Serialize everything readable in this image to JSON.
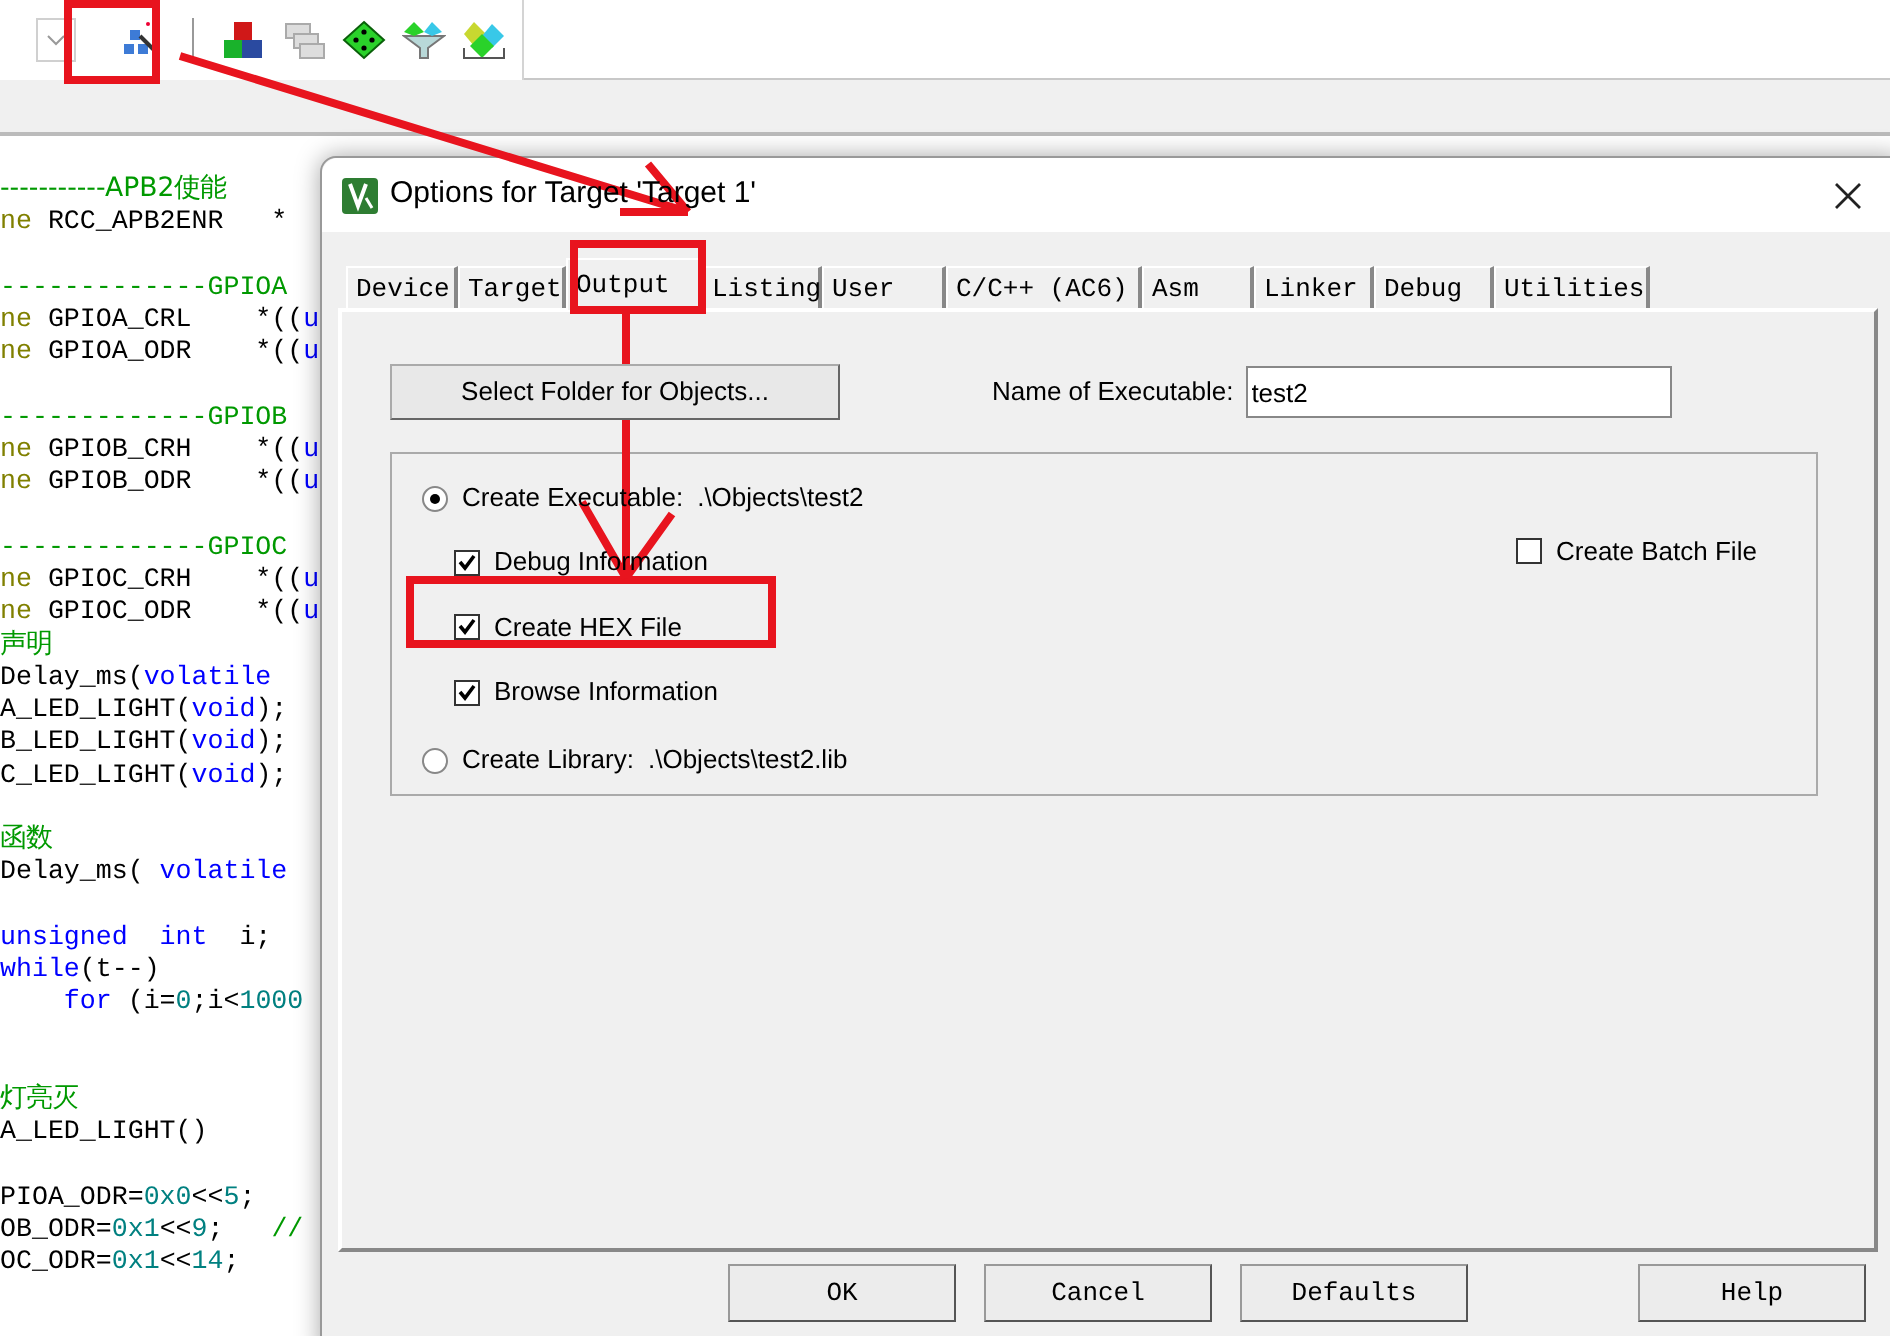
{
  "toolbar": {
    "buttons": [
      {
        "kind": "dropdown"
      },
      {
        "kind": "wand"
      },
      {
        "kind": "separator"
      },
      {
        "kind": "blocks"
      },
      {
        "kind": "windows"
      },
      {
        "kind": "diamond"
      },
      {
        "kind": "funnel"
      },
      {
        "kind": "packs"
      }
    ]
  },
  "code": {
    "lines": [
      {
        "kind": "code",
        "segments": [
          {
            "kind": "comment",
            "t": "-----------APB2使能"
          }
        ]
      },
      {
        "kind": "code",
        "segments": [
          {
            "kind": "macro",
            "t": "ne"
          },
          {
            "kind": "plain",
            "t": " RCC_APB2ENR   *"
          }
        ]
      },
      {
        "kind": "blank"
      },
      {
        "kind": "code",
        "segments": [
          {
            "kind": "comment",
            "t": "-------------GPIOA"
          }
        ]
      },
      {
        "kind": "code",
        "segments": [
          {
            "kind": "macro",
            "t": "ne"
          },
          {
            "kind": "plain",
            "t": " GPIOA_CRL    *(("
          },
          {
            "kind": "keyword",
            "t": "u"
          }
        ]
      },
      {
        "kind": "code",
        "segments": [
          {
            "kind": "macro",
            "t": "ne"
          },
          {
            "kind": "plain",
            "t": " GPIOA_ODR    *(("
          },
          {
            "kind": "keyword",
            "t": "u"
          }
        ]
      },
      {
        "kind": "blank"
      },
      {
        "kind": "code",
        "segments": [
          {
            "kind": "comment",
            "t": "-------------GPIOB"
          }
        ]
      },
      {
        "kind": "code",
        "segments": [
          {
            "kind": "macro",
            "t": "ne"
          },
          {
            "kind": "plain",
            "t": " GPIOB_CRH    *(("
          },
          {
            "kind": "keyword",
            "t": "u"
          }
        ]
      },
      {
        "kind": "code",
        "segments": [
          {
            "kind": "macro",
            "t": "ne"
          },
          {
            "kind": "plain",
            "t": " GPIOB_ODR    *(("
          },
          {
            "kind": "keyword",
            "t": "u"
          }
        ]
      },
      {
        "kind": "blank"
      },
      {
        "kind": "code",
        "segments": [
          {
            "kind": "comment",
            "t": "-------------GPIOC"
          }
        ]
      },
      {
        "kind": "code",
        "segments": [
          {
            "kind": "macro",
            "t": "ne"
          },
          {
            "kind": "plain",
            "t": " GPIOC_CRH    *(("
          },
          {
            "kind": "keyword",
            "t": "u"
          }
        ]
      },
      {
        "kind": "code",
        "segments": [
          {
            "kind": "macro",
            "t": "ne"
          },
          {
            "kind": "plain",
            "t": " GPIOC_ODR    *(("
          },
          {
            "kind": "keyword",
            "t": "u"
          }
        ]
      },
      {
        "kind": "code",
        "segments": [
          {
            "kind": "comment",
            "t": "声明"
          }
        ]
      },
      {
        "kind": "code",
        "segments": [
          {
            "kind": "plain",
            "t": "Delay_ms("
          },
          {
            "kind": "keyword",
            "t": "volatile"
          }
        ]
      },
      {
        "kind": "code",
        "segments": [
          {
            "kind": "plain",
            "t": "A_LED_LIGHT("
          },
          {
            "kind": "keyword",
            "t": "void"
          },
          {
            "kind": "plain",
            "t": ");"
          }
        ]
      },
      {
        "kind": "code",
        "segments": [
          {
            "kind": "plain",
            "t": "B_LED_LIGHT("
          },
          {
            "kind": "keyword",
            "t": "void"
          },
          {
            "kind": "plain",
            "t": ");"
          }
        ]
      },
      {
        "kind": "code",
        "segments": [
          {
            "kind": "plain",
            "t": "C_LED_LIGHT("
          },
          {
            "kind": "keyword",
            "t": "void"
          },
          {
            "kind": "plain",
            "t": ");"
          }
        ]
      },
      {
        "kind": "blank"
      },
      {
        "kind": "code",
        "segments": [
          {
            "kind": "comment",
            "t": "函数"
          }
        ]
      },
      {
        "kind": "code",
        "segments": [
          {
            "kind": "plain",
            "t": "Delay_ms( "
          },
          {
            "kind": "keyword",
            "t": "volatile"
          }
        ]
      },
      {
        "kind": "blank"
      },
      {
        "kind": "code",
        "segments": [
          {
            "kind": "keyword",
            "t": "unsigned  int"
          },
          {
            "kind": "plain",
            "t": "  i;"
          }
        ]
      },
      {
        "kind": "code",
        "segments": [
          {
            "kind": "keyword",
            "t": "while"
          },
          {
            "kind": "plain",
            "t": "(t--)"
          }
        ]
      },
      {
        "kind": "code",
        "segments": [
          {
            "kind": "keyword",
            "t": "    for"
          },
          {
            "kind": "plain",
            "t": " (i="
          },
          {
            "kind": "number",
            "t": "0"
          },
          {
            "kind": "plain",
            "t": ";i<"
          },
          {
            "kind": "number",
            "t": "1000"
          }
        ]
      },
      {
        "kind": "blank"
      },
      {
        "kind": "blank"
      },
      {
        "kind": "code",
        "segments": [
          {
            "kind": "comment",
            "t": "灯亮灭"
          }
        ]
      },
      {
        "kind": "code",
        "segments": [
          {
            "kind": "plain",
            "t": "A_LED_LIGHT()"
          }
        ]
      },
      {
        "kind": "blank"
      },
      {
        "kind": "code",
        "segments": [
          {
            "kind": "plain",
            "t": "PIOA_ODR="
          },
          {
            "kind": "number",
            "t": "0x0"
          },
          {
            "kind": "plain",
            "t": "<<"
          },
          {
            "kind": "number",
            "t": "5"
          },
          {
            "kind": "plain",
            "t": ";"
          }
        ]
      },
      {
        "kind": "code",
        "segments": [
          {
            "kind": "plain",
            "t": "OB_ODR="
          },
          {
            "kind": "number",
            "t": "0x1"
          },
          {
            "kind": "plain",
            "t": "<<"
          },
          {
            "kind": "number",
            "t": "9"
          },
          {
            "kind": "plain",
            "t": ";   "
          },
          {
            "kind": "comment",
            "t": "//"
          }
        ]
      },
      {
        "kind": "code",
        "segments": [
          {
            "kind": "plain",
            "t": "OC_ODR="
          },
          {
            "kind": "number",
            "t": "0x1"
          },
          {
            "kind": "plain",
            "t": "<<"
          },
          {
            "kind": "number",
            "t": "14"
          },
          {
            "kind": "plain",
            "t": ";"
          }
        ]
      }
    ]
  },
  "dialog": {
    "title": "Options for Target 'Target 1'",
    "tabs": [
      {
        "label": "Device",
        "selected": false
      },
      {
        "label": "Target",
        "selected": false
      },
      {
        "label": "Output",
        "selected": true
      },
      {
        "label": "Listing",
        "selected": false
      },
      {
        "label": "User",
        "selected": false
      },
      {
        "label": "C/C++ (AC6)",
        "selected": false
      },
      {
        "label": "Asm",
        "selected": false
      },
      {
        "label": "Linker",
        "selected": false
      },
      {
        "label": "Debug",
        "selected": false
      },
      {
        "label": "Utilities",
        "selected": false
      }
    ],
    "select_folder_button": "Select Folder for Objects...",
    "name_of_executable": {
      "label": "Name of Executable:",
      "value": "test2"
    },
    "create_executable": {
      "label": "Create Executable:",
      "path": ".\\Objects\\test2",
      "selected": true
    },
    "options": [
      {
        "label": "Debug Information",
        "checked": true
      },
      {
        "label": "Create HEX File",
        "checked": true
      },
      {
        "label": "Browse Information",
        "checked": true
      }
    ],
    "create_batch_file": {
      "label": "Create Batch File",
      "checked": false
    },
    "create_library": {
      "label": "Create Library:",
      "path": ".\\Objects\\test2.lib",
      "selected": false
    },
    "buttons": [
      "OK",
      "Cancel",
      "Defaults",
      "Help"
    ]
  },
  "annotations": [
    {
      "kind": "box"
    },
    {
      "kind": "box"
    },
    {
      "kind": "box"
    },
    {
      "kind": "arrow"
    },
    {
      "kind": "arrow"
    }
  ]
}
